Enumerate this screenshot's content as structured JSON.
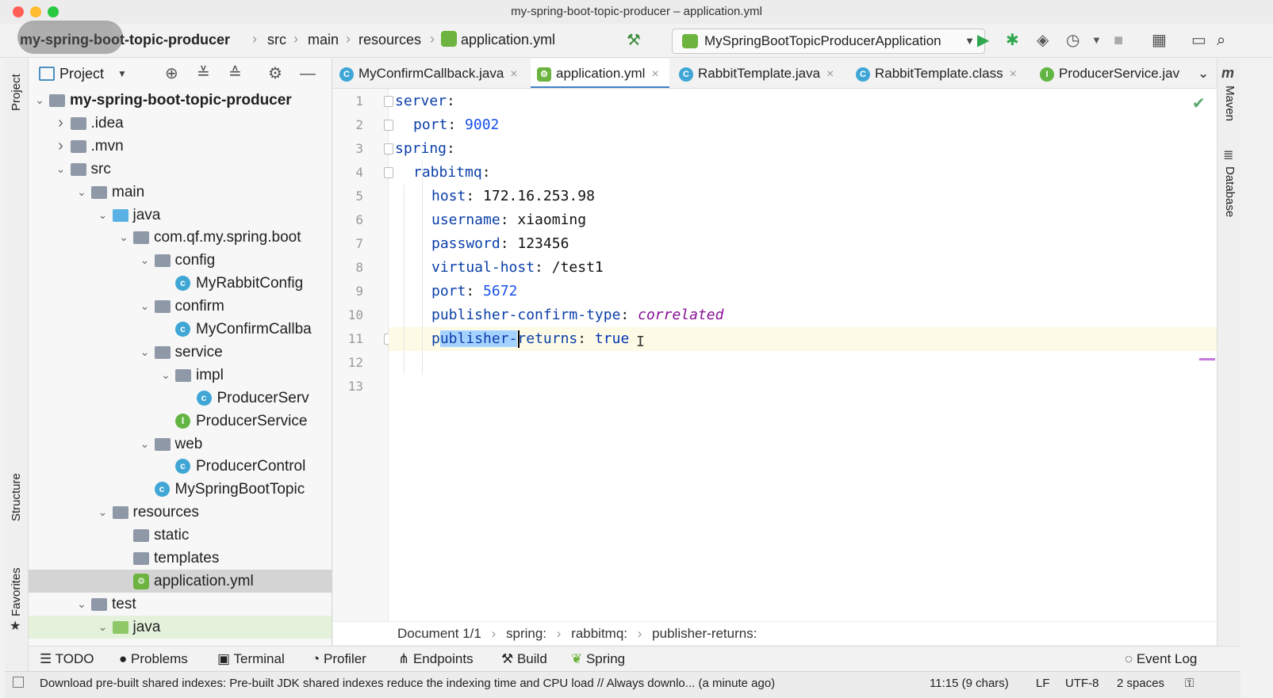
{
  "window": {
    "title": "my-spring-boot-topic-producer – application.yml"
  },
  "breadcrumb": [
    "my-spring-boot-topic-producer",
    "src",
    "main",
    "resources",
    "application.yml"
  ],
  "run_config": {
    "label": "MySpringBootTopicProducerApplication"
  },
  "project_panel": {
    "title": "Project"
  },
  "tree": [
    {
      "label": "my-spring-boot-topic-producer",
      "depth": 0,
      "arrow": "down",
      "icon": "module",
      "bold": true
    },
    {
      "label": ".idea",
      "depth": 1,
      "arrow": "right",
      "icon": "folder"
    },
    {
      "label": ".mvn",
      "depth": 1,
      "arrow": "right",
      "icon": "folder"
    },
    {
      "label": "src",
      "depth": 1,
      "arrow": "down",
      "icon": "folder"
    },
    {
      "label": "main",
      "depth": 2,
      "arrow": "down",
      "icon": "folder"
    },
    {
      "label": "java",
      "depth": 3,
      "arrow": "down",
      "icon": "folder-blue"
    },
    {
      "label": "com.qf.my.spring.boot",
      "depth": 4,
      "arrow": "down",
      "icon": "package"
    },
    {
      "label": "config",
      "depth": 5,
      "arrow": "down",
      "icon": "package"
    },
    {
      "label": "MyRabbitConfig",
      "depth": 6,
      "arrow": "",
      "icon": "class"
    },
    {
      "label": "confirm",
      "depth": 5,
      "arrow": "down",
      "icon": "package"
    },
    {
      "label": "MyConfirmCallba",
      "depth": 6,
      "arrow": "",
      "icon": "class"
    },
    {
      "label": "service",
      "depth": 5,
      "arrow": "down",
      "icon": "package"
    },
    {
      "label": "impl",
      "depth": 6,
      "arrow": "down",
      "icon": "package"
    },
    {
      "label": "ProducerServ",
      "depth": 7,
      "arrow": "",
      "icon": "class"
    },
    {
      "label": "ProducerService",
      "depth": 6,
      "arrow": "",
      "icon": "interface"
    },
    {
      "label": "web",
      "depth": 5,
      "arrow": "down",
      "icon": "package"
    },
    {
      "label": "ProducerControl",
      "depth": 6,
      "arrow": "",
      "icon": "class"
    },
    {
      "label": "MySpringBootTopic",
      "depth": 5,
      "arrow": "",
      "icon": "spring-class"
    },
    {
      "label": "resources",
      "depth": 3,
      "arrow": "down",
      "icon": "folder"
    },
    {
      "label": "static",
      "depth": 4,
      "arrow": "",
      "icon": "folder"
    },
    {
      "label": "templates",
      "depth": 4,
      "arrow": "",
      "icon": "folder"
    },
    {
      "label": "application.yml",
      "depth": 4,
      "arrow": "",
      "icon": "yml",
      "selected": true
    },
    {
      "label": "test",
      "depth": 2,
      "arrow": "down",
      "icon": "folder"
    },
    {
      "label": "java",
      "depth": 3,
      "arrow": "down",
      "icon": "folder-green",
      "highlight": true
    }
  ],
  "tabs": [
    {
      "label": "MyConfirmCallback.java",
      "icon": "C"
    },
    {
      "label": "application.yml",
      "icon": "yml",
      "active": true
    },
    {
      "label": "RabbitTemplate.java",
      "icon": "C"
    },
    {
      "label": "RabbitTemplate.class",
      "icon": "C"
    },
    {
      "label": "ProducerService.jav",
      "icon": "I"
    }
  ],
  "editor": {
    "line_numbers": [
      "1",
      "2",
      "3",
      "4",
      "5",
      "6",
      "7",
      "8",
      "9",
      "10",
      "11",
      "12",
      "13"
    ],
    "lines": [
      {
        "indent": 0,
        "key": "server",
        "value": ""
      },
      {
        "indent": 1,
        "key": "port",
        "value": "9002",
        "type": "num"
      },
      {
        "indent": 0,
        "key": "spring",
        "value": ""
      },
      {
        "indent": 1,
        "key": "rabbitmq",
        "value": ""
      },
      {
        "indent": 2,
        "key": "host",
        "value": "172.16.253.98",
        "type": "str"
      },
      {
        "indent": 2,
        "key": "username",
        "value": "xiaoming",
        "type": "str"
      },
      {
        "indent": 2,
        "key": "password",
        "value": "123456",
        "type": "str"
      },
      {
        "indent": 2,
        "key": "virtual-host",
        "value": "/test1",
        "type": "str"
      },
      {
        "indent": 2,
        "key": "port",
        "value": "5672",
        "type": "num"
      },
      {
        "indent": 2,
        "key": "publisher-confirm-type",
        "value": "correlated",
        "type": "enum"
      },
      {
        "indent": 2,
        "key": "publisher-returns",
        "value": "true",
        "type": "kw",
        "current": true
      },
      {
        "indent": 0,
        "key": "",
        "value": ""
      },
      {
        "indent": 0,
        "key": "",
        "value": ""
      }
    ]
  },
  "editor_breadcrumb": [
    "Document 1/1",
    "spring:",
    "rabbitmq:",
    "publisher-returns:"
  ],
  "tool_windows": [
    "TODO",
    "Problems",
    "Terminal",
    "Profiler",
    "Endpoints",
    "Build",
    "Spring"
  ],
  "event_log": "Event Log",
  "side_labels": {
    "left_top": "Project",
    "left_mid": "Structure",
    "left_bot": "Favorites",
    "right_top": "Maven",
    "right_mid": "Database"
  },
  "status": {
    "message": "Download pre-built shared indexes: Pre-built JDK shared indexes reduce the indexing time and CPU load // Always downlo... (a minute ago)",
    "position": "11:15 (9 chars)",
    "line_sep": "LF",
    "encoding": "UTF-8",
    "indent": "2 spaces"
  },
  "colors": {
    "accent": "#4083c9",
    "run": "#59a869",
    "selection": "#a6d2ff",
    "current_line": "#fdfbe6"
  }
}
